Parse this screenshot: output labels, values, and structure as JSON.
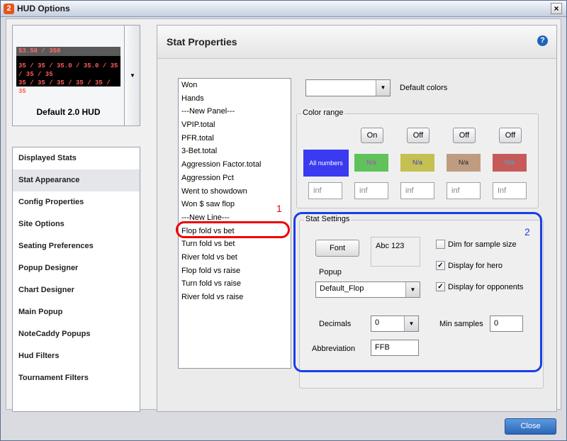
{
  "window": {
    "title": "HUD Options",
    "app_icon": "2"
  },
  "hud_preview": {
    "caption": "Default 2.0 HUD",
    "line1": "$3.50 / 350",
    "line2": "35 / 35 / 35.0 / 35.0 / 35 / 35 / 35",
    "line3": "35 / 35 / 35 / 35 / 35 / 35",
    "dropdown_icon": "chevron-down-icon"
  },
  "nav": {
    "items": [
      {
        "label": "Displayed Stats"
      },
      {
        "label": "Stat Appearance"
      },
      {
        "label": "Config Properties"
      },
      {
        "label": "Site Options"
      },
      {
        "label": "Seating Preferences"
      },
      {
        "label": "Popup Designer"
      },
      {
        "label": "Chart Designer"
      },
      {
        "label": "Main Popup"
      },
      {
        "label": "NoteCaddy Popups"
      },
      {
        "label": "Hud Filters"
      },
      {
        "label": "Tournament Filters"
      }
    ],
    "active": "Stat Appearance"
  },
  "panel": {
    "title": "Stat Properties",
    "help_icon": "help-icon"
  },
  "stats": [
    {
      "label": "Won"
    },
    {
      "label": "Hands"
    },
    {
      "label": "---New Panel---"
    },
    {
      "label": "VPIP.total"
    },
    {
      "label": "PFR.total"
    },
    {
      "label": "3-Bet.total"
    },
    {
      "label": "Aggression Factor.total"
    },
    {
      "label": "Aggression Pct"
    },
    {
      "label": "Went to showdown"
    },
    {
      "label": "Won $ saw flop"
    },
    {
      "label": "---New Line---"
    },
    {
      "label": "Flop fold vs bet"
    },
    {
      "label": "Turn fold vs bet"
    },
    {
      "label": "River fold vs bet"
    },
    {
      "label": "Flop fold vs raise"
    },
    {
      "label": "Turn fold vs raise"
    },
    {
      "label": "River fold vs raise"
    }
  ],
  "annotations": {
    "one": "1",
    "two": "2"
  },
  "default_colors": {
    "label": "Default colors",
    "value": ""
  },
  "color_range": {
    "label": "Color range",
    "toggles": [
      "On",
      "Off",
      "Off",
      "Off"
    ],
    "swatches": [
      {
        "label": "All numbers",
        "bg": "#3a3af0",
        "fg": "#ffffff"
      },
      {
        "label": "N/a",
        "bg": "#5fc25a",
        "fg": "#c03acb"
      },
      {
        "label": "N/a",
        "bg": "#c5c052",
        "fg": "#3a3ad0"
      },
      {
        "label": "N/a",
        "bg": "#bf9c80",
        "fg": "#222222"
      },
      {
        "label": "N/a",
        "bg": "#c65a5a",
        "fg": "#3ab0cf"
      }
    ],
    "inputs": [
      "inf",
      "inf",
      "inf",
      "inf",
      "Inf"
    ]
  },
  "stat_settings": {
    "label": "Stat Settings",
    "font_button": "Font",
    "preview_text": "Abc 123",
    "popup_label": "Popup",
    "popup_value": "Default_Flop",
    "decimals_label": "Decimals",
    "decimals_value": "0",
    "abbreviation_label": "Abbreviation",
    "abbreviation_value": "FFB",
    "min_samples_label": "Min samples",
    "min_samples_value": "0",
    "dim_label": "Dim for sample size",
    "dim_checked": false,
    "hero_label": "Display for hero",
    "hero_checked": true,
    "opponents_label": "Display for opponents",
    "opponents_checked": true,
    "check_mark": "✓"
  },
  "footer": {
    "close_label": "Close"
  }
}
